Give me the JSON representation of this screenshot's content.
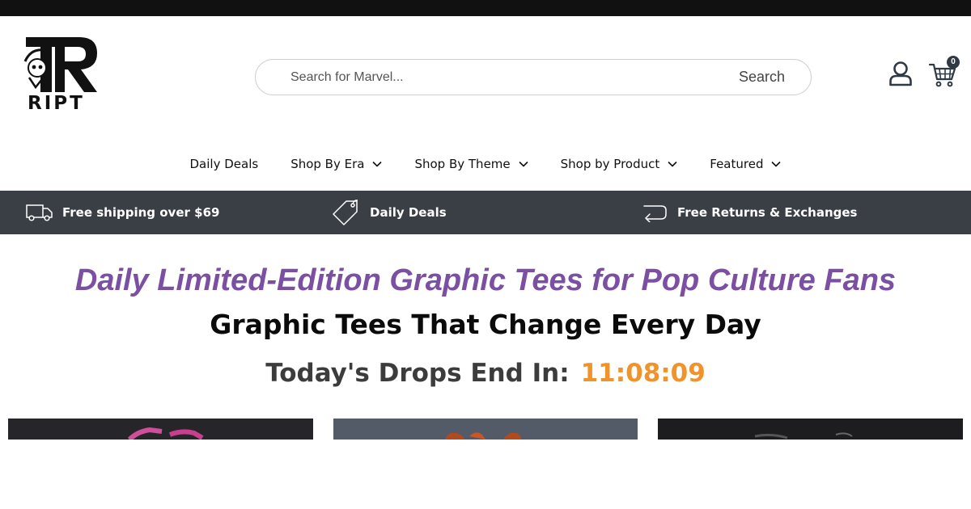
{
  "brand": {
    "name": "RIPT"
  },
  "search": {
    "placeholder": "Search for Marvel...",
    "button_label": "Search"
  },
  "header": {
    "account_icon": "user-icon",
    "cart_icon": "cart-icon",
    "cart_count": "0"
  },
  "nav": {
    "items": [
      {
        "label": "Daily Deals",
        "has_dropdown": false
      },
      {
        "label": "Shop By Era",
        "has_dropdown": true
      },
      {
        "label": "Shop By Theme",
        "has_dropdown": true
      },
      {
        "label": "Shop by Product",
        "has_dropdown": true
      },
      {
        "label": "Featured",
        "has_dropdown": true
      }
    ]
  },
  "benefits": [
    {
      "icon": "truck-icon",
      "label": "Free shipping over $69"
    },
    {
      "icon": "tag-icon",
      "label": "Daily Deals"
    },
    {
      "icon": "return-arrow-icon",
      "label": "Free Returns & Exchanges"
    }
  ],
  "hero": {
    "title": "Daily Limited-Edition Graphic Tees for Pop Culture Fans",
    "subtitle": "Graphic Tees That Change Every Day",
    "countdown_label": "Today's Drops End In:",
    "countdown_time": "11:08:09"
  },
  "colors": {
    "accent_purple": "#7b4fa2",
    "countdown_orange": "#f0932b",
    "benefit_bar": "#3a3f46",
    "top_strip": "#111111"
  },
  "products": [
    {
      "name": "product-card-1",
      "bg": "#26262a"
    },
    {
      "name": "product-card-2",
      "bg": "#515a66"
    },
    {
      "name": "product-card-3",
      "bg": "#1e1e20"
    }
  ]
}
